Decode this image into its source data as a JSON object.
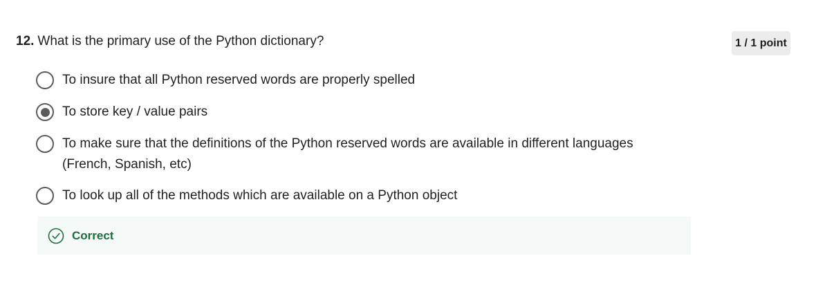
{
  "question": {
    "number": "12.",
    "text": "What is the primary use of the Python dictionary?",
    "score": "1 / 1 point"
  },
  "options": [
    {
      "label": "To insure that all Python reserved words are properly spelled",
      "selected": false
    },
    {
      "label": "To store key / value pairs",
      "selected": true
    },
    {
      "label": "To make sure that the definitions of the Python reserved words are available in different languages (French, Spanish, etc)",
      "selected": false
    },
    {
      "label": "To look up all of the methods which are available on a Python object",
      "selected": false
    }
  ],
  "feedback": {
    "status": "Correct",
    "icon": "check-circle-icon",
    "color": "#1c6e3b"
  },
  "colors": {
    "radio": "#5b5b5b",
    "badge_bg": "#ececec",
    "feedback_bg": "#f5f9f8"
  }
}
